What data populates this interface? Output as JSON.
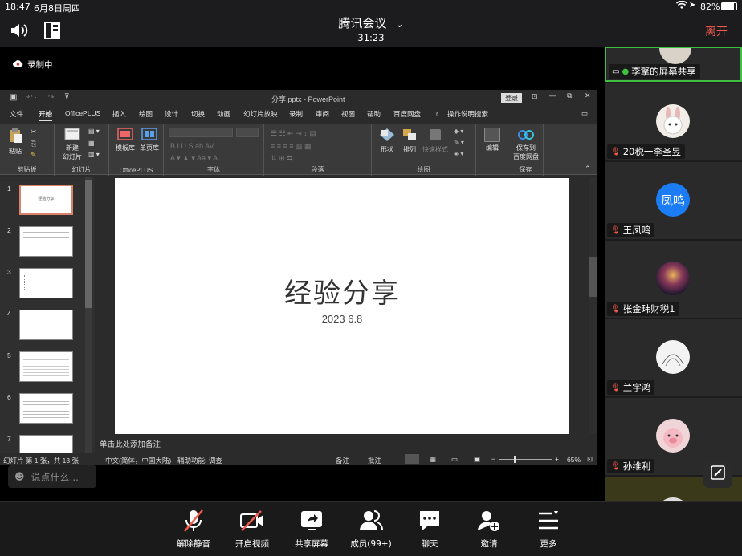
{
  "status": {
    "time": "18:47",
    "date": "6月8日周四",
    "battery": "82%"
  },
  "meeting": {
    "title": "腾讯会议",
    "duration": "31:23",
    "leave_label": "离开",
    "recording_label": "录制中",
    "chat_placeholder": "说点什么..."
  },
  "ppt": {
    "window_title": "分享.pptx - PowerPoint",
    "login_label": "登录",
    "tabs": [
      "文件",
      "开始",
      "OfficePLUS",
      "插入",
      "绘图",
      "设计",
      "切换",
      "动画",
      "幻灯片放映",
      "录制",
      "审阅",
      "视图",
      "帮助",
      "百度网盘"
    ],
    "tell_me": "操作说明搜索",
    "groups": {
      "clipboard": "剪贴板",
      "slides": "幻灯片",
      "officeplus": "OfficePLUS",
      "font": "字体",
      "paragraph": "段落",
      "drawing": "绘图",
      "save": "保存"
    },
    "buttons": {
      "paste": "粘贴",
      "new_slide": "新建\n幻灯片",
      "template": "模板库",
      "single_page": "单页库",
      "shape": "形状",
      "arrange": "排列",
      "quick_style": "快速样式",
      "edit": "编辑",
      "save_baidu": "保存到\n百度网盘"
    },
    "slide": {
      "title": "经验分享",
      "subtitle": "2023 6.8"
    },
    "thumb_numbers": [
      "1",
      "2",
      "3",
      "4",
      "5",
      "6",
      "7"
    ],
    "thumb1_title": "经验分享",
    "notes_placeholder": "单击此处添加备注",
    "statusbar": {
      "slide_info": "幻灯片 第 1 张，共 13 张",
      "language": "中文(简体，中国大陆)",
      "accessibility": "辅助功能: 调查",
      "notes": "备注",
      "comments": "批注",
      "zoom": "65%"
    }
  },
  "participants": [
    {
      "name": "李擎的屏幕共享",
      "avatar_color": "#d9d2c8"
    },
    {
      "name": "20税一李圣昱",
      "avatar_color": "#f2ede6"
    },
    {
      "name": "王凤鸣",
      "avatar_text": "凤鸣",
      "avatar_color": "#1b7cf5"
    },
    {
      "name": "张金玮财税1",
      "avatar_color": "#3a2a3a"
    },
    {
      "name": "兰宇鸿",
      "avatar_color": "#f3f3f3"
    },
    {
      "name": "孙维利",
      "avatar_color": "#f0d5d8"
    }
  ],
  "toolbar": {
    "unmute": "解除静音",
    "video": "开启视频",
    "share": "共享屏幕",
    "members": "成员(99+)",
    "chat": "聊天",
    "invite": "邀请",
    "more": "更多"
  },
  "colors": {
    "accent_red": "#f55a4e",
    "active_green": "#3fbf3f",
    "blue_avatar": "#1b7cf5"
  }
}
